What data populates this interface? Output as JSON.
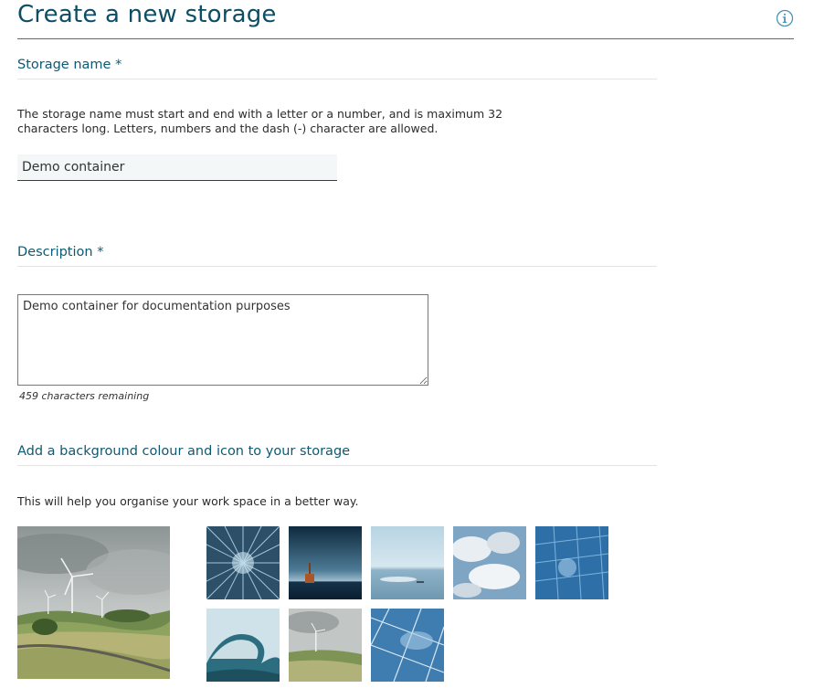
{
  "page": {
    "title": "Create a new storage",
    "info_icon": "info-icon"
  },
  "storage_name": {
    "label": "Storage name *",
    "help": "The storage name must start and end with a letter or a number, and is maximum 32 characters long. Letters, numbers and the dash (-) character are allowed.",
    "value": "Demo container"
  },
  "description": {
    "label": "Description *",
    "value": "Demo container for documentation purposes",
    "remaining": "459 characters remaining"
  },
  "background": {
    "label": "Add a background colour and icon to your storage",
    "help": "This will help you organise your work space in a better way.",
    "preview": "wind-turbines-landscape",
    "thumbnails": [
      "blue-burst-abstract",
      "offshore-rig-at-dusk",
      "calm-sea-with-ships",
      "clouds-in-blue-sky",
      "solar-panel-closeup",
      "ocean-wave",
      "wind-turbines-field",
      "solar-panels-reflection"
    ]
  },
  "colors": {
    "title": "#0e4e64",
    "label": "#0e5a72",
    "accent": "#0e4e64"
  }
}
